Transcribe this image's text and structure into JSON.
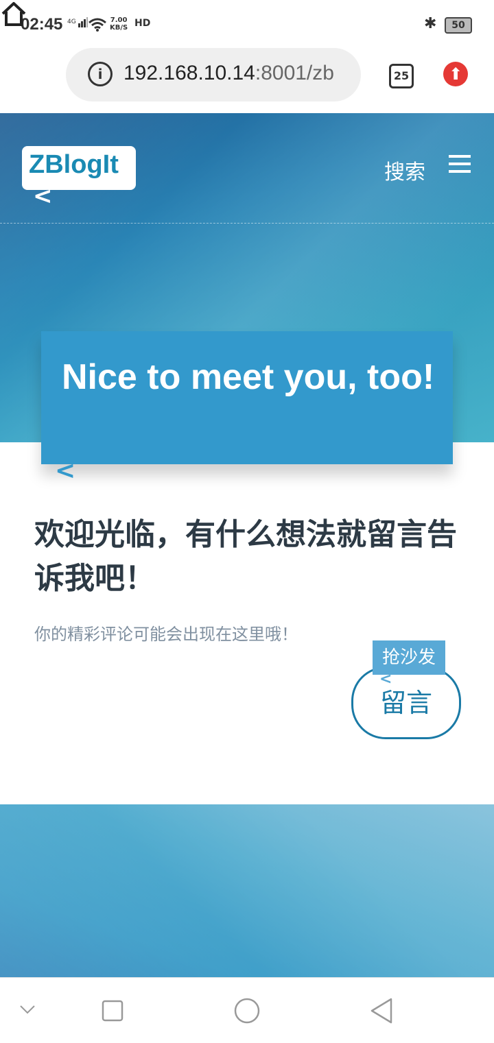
{
  "status_bar": {
    "time": "02:45",
    "network": "4G",
    "speed_value": "7.00",
    "speed_unit": "KB/S",
    "hd": "HD",
    "battery": "50"
  },
  "browser": {
    "url_host": "192.168.10.14",
    "url_rest": ":8001/zb",
    "tab_count": "25"
  },
  "site": {
    "logo": "ZBlogIt",
    "search_label": "搜索"
  },
  "hero": {
    "title": "Nice to meet you, too!"
  },
  "content": {
    "heading": "欢迎光临，有什么想法就留言告诉我吧！",
    "subtitle": "你的精彩评论可能会出现在这里哦！",
    "sofa_label": "抢沙发",
    "message_button": "留言"
  },
  "colors": {
    "accent": "#3399cc",
    "logo_text": "#1a8ab3",
    "button_border": "#1a7aa6"
  }
}
